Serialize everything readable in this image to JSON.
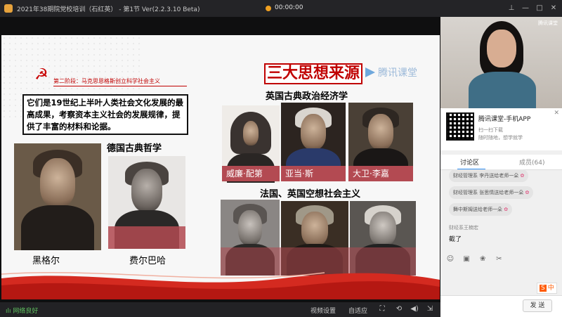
{
  "titlebar": {
    "title": "2021年38期院党校培训（石红英） - 第1节 Ver(2.2.3.10 Beta)",
    "timer": "00:00:00",
    "icons": [
      "app-icon",
      "record-icon",
      "pin-icon",
      "minimize-icon",
      "maximize-icon",
      "close-icon"
    ]
  },
  "slide": {
    "stage": "第二阶段：马克思恩格斯创立科学社会主义",
    "title": "三大思想来源",
    "watermark": "腾讯课堂",
    "quote": "它们是19世纪上半叶人类社会文化发展的最高成果，考察资本主义社会的发展规律，提供了丰富的材料和论据。",
    "sections": {
      "german": "德国古典哲学",
      "english": "英国古典政治经济学",
      "utopian": "法国、英国空想社会主义"
    },
    "names": {
      "hegel": "黑格尔",
      "feuerbach": "费尔巴哈",
      "petty": "威廉·配第",
      "smith": "亚当·斯",
      "ricardo": "大卫·李嘉"
    }
  },
  "bottombar": {
    "network": "网络良好",
    "video_settings": "视频设置",
    "fit": "自适应"
  },
  "right": {
    "video_badge": "腾讯课堂",
    "promo_title": "腾讯课堂-手机APP",
    "promo_sub1": "扫一扫下载",
    "promo_sub2": "随时随地，想学就学",
    "tabs": {
      "discussion": "讨论区",
      "members": "成员(64)"
    },
    "gifts": [
      "财经管理系 李丹送给老师一朵",
      "财经管理系 张思情送给老师一朵",
      "舞中斯姆送给老师一朵"
    ],
    "chat": {
      "name": "财经系王楠宏",
      "message": "截了"
    },
    "send": "发 送",
    "ime": "中"
  },
  "colors": {
    "accent_red": "#c00000",
    "tab_blue": "#2d8cf0"
  }
}
